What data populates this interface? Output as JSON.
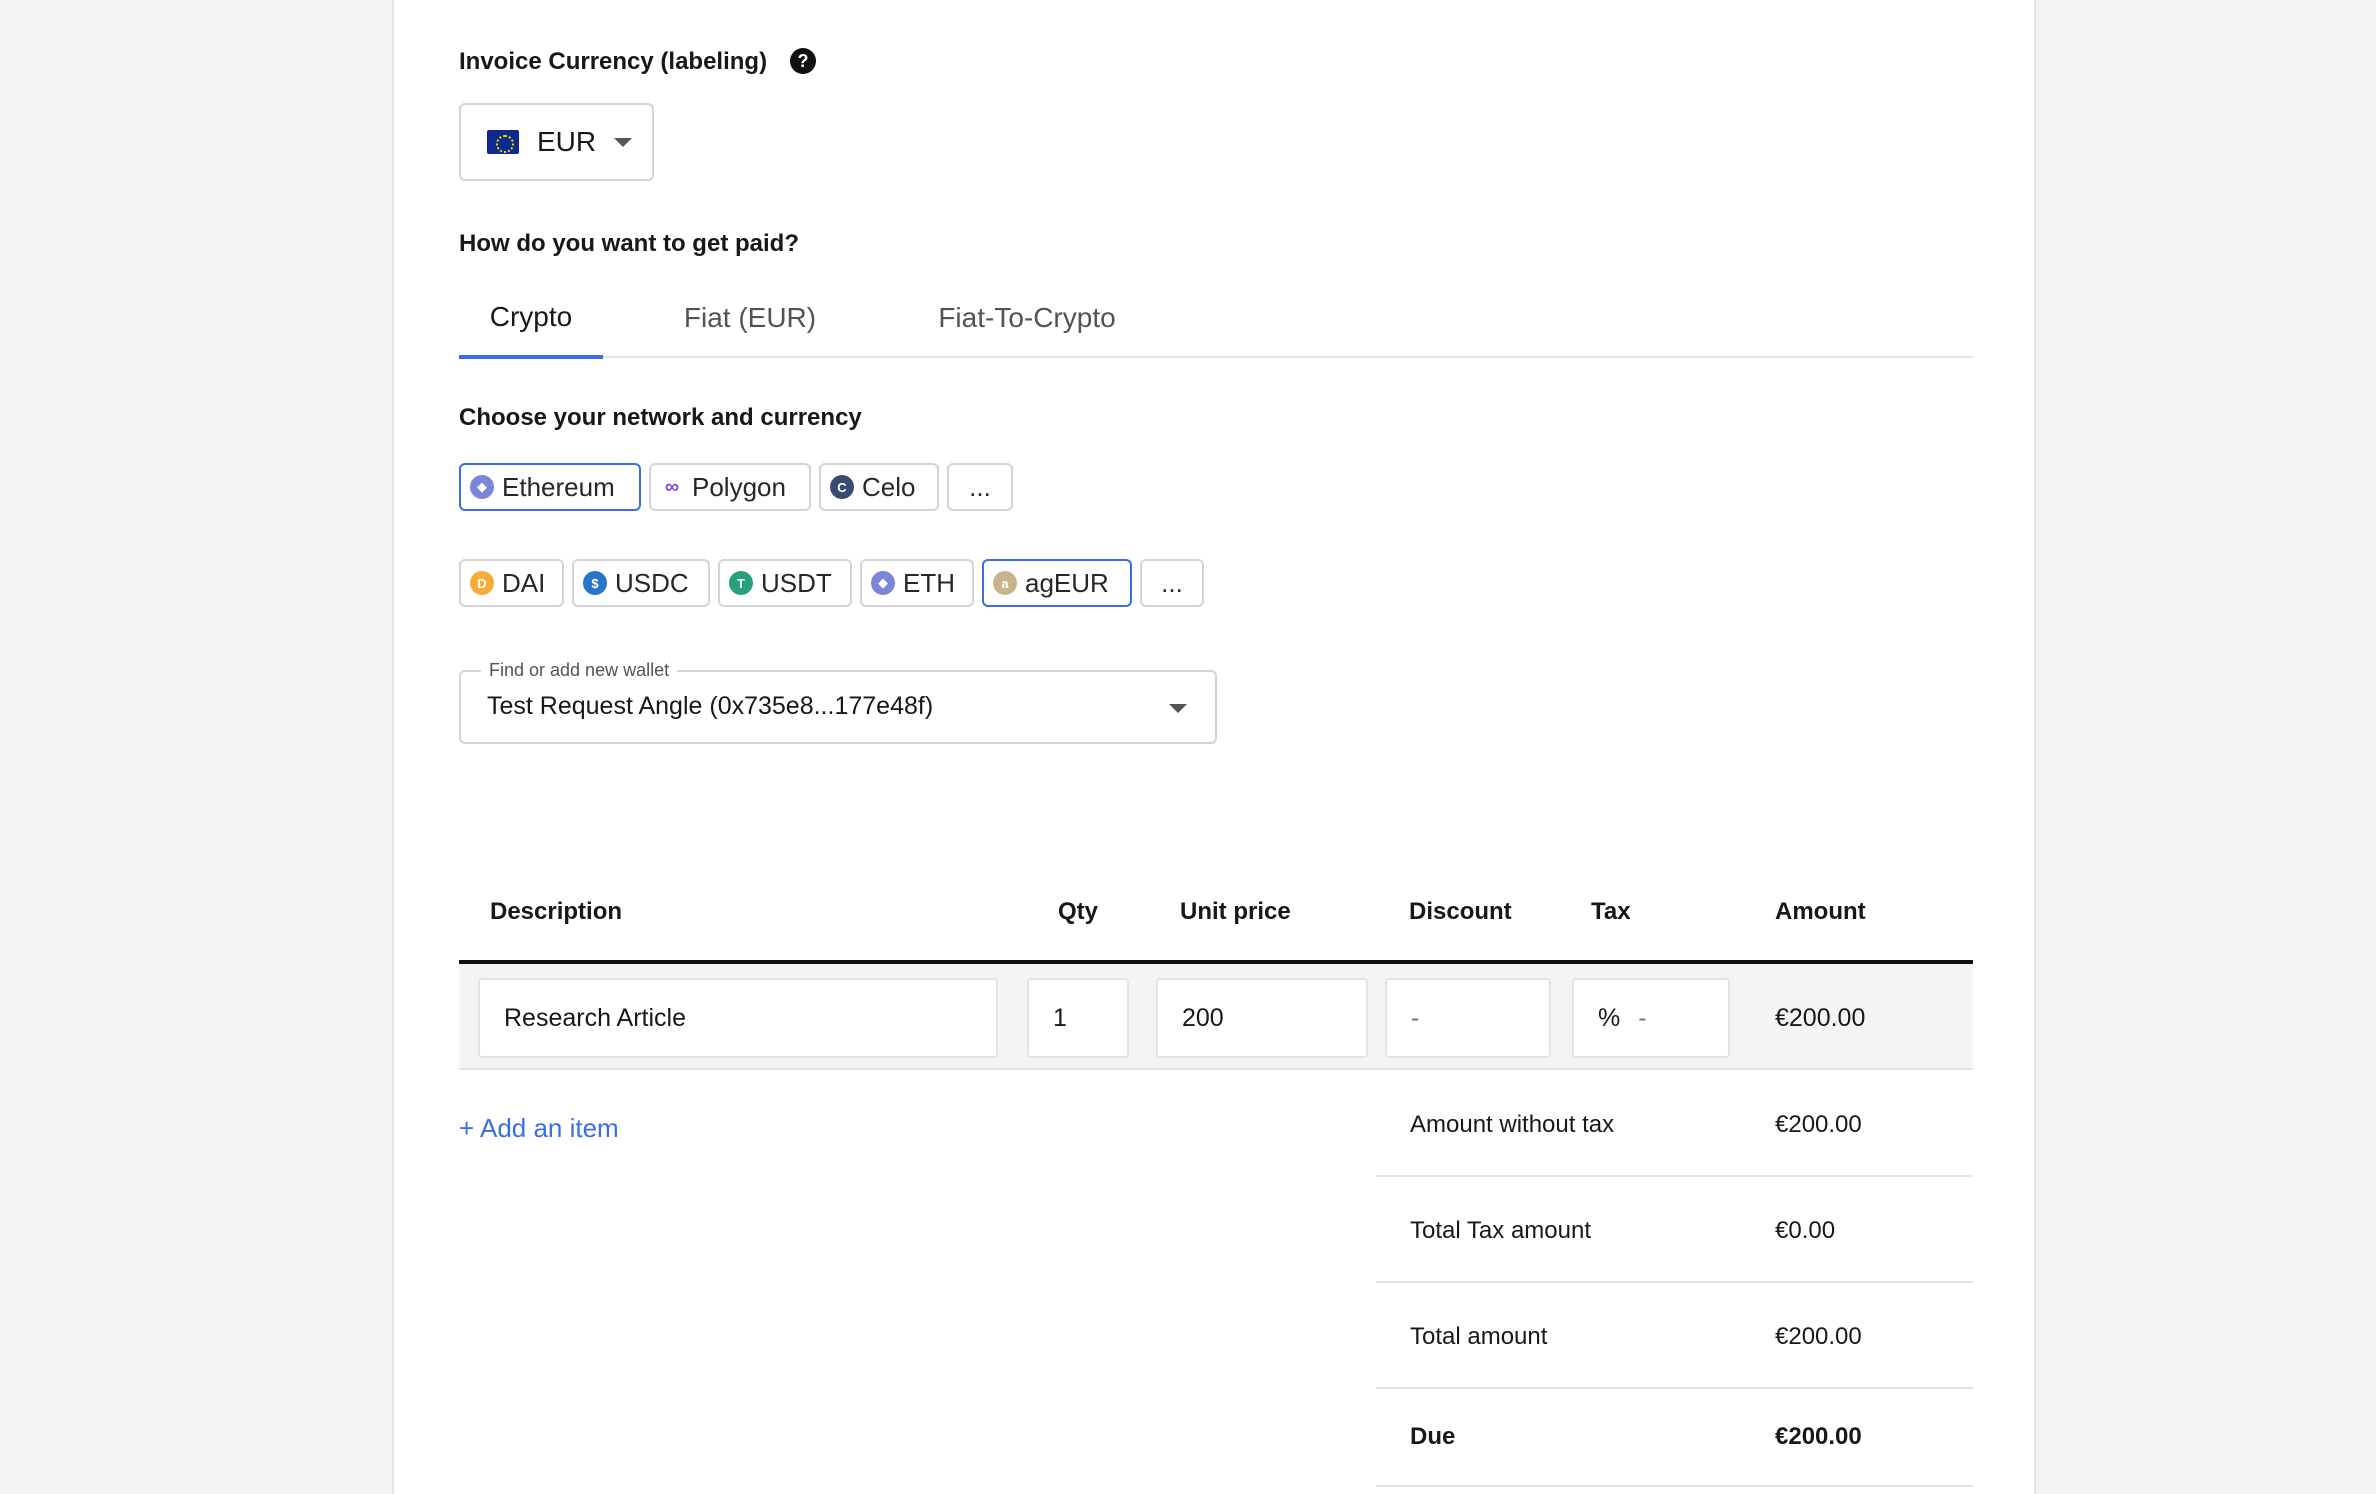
{
  "invoice_currency": {
    "label": "Invoice Currency (labeling)",
    "help_icon": "?",
    "selected": "EUR",
    "flag_icon": "eu-flag-icon"
  },
  "payment": {
    "question": "How do you want to get paid?",
    "tabs": [
      "Crypto",
      "Fiat (EUR)",
      "Fiat-To-Crypto"
    ],
    "active_tab": "Crypto",
    "accent_color": "#3b6fe0"
  },
  "network": {
    "label": "Choose your network and currency",
    "networks": [
      "Ethereum",
      "Polygon",
      "Celo",
      "..."
    ],
    "selected_network": "Ethereum",
    "currencies": [
      "DAI",
      "USDC",
      "USDT",
      "ETH",
      "agEUR",
      "..."
    ],
    "selected_currency": "agEUR"
  },
  "wallet": {
    "legend": "Find or add new wallet",
    "value": "Test Request Angle (0x735e8...177e48f)"
  },
  "table": {
    "headers": {
      "description": "Description",
      "qty": "Qty",
      "unit_price": "Unit price",
      "discount": "Discount",
      "tax": "Tax",
      "amount": "Amount"
    },
    "row": {
      "description": "Research Article",
      "qty": "1",
      "unit_price": "200",
      "discount": "-",
      "tax_unit": "%",
      "tax": "-",
      "amount": "€200.00"
    },
    "add_item": "+ Add an item"
  },
  "summary": {
    "amount_without_tax_label": "Amount without tax",
    "amount_without_tax": "€200.00",
    "total_tax_label": "Total Tax amount",
    "total_tax": "€0.00",
    "total_amount_label": "Total amount",
    "total_amount": "€200.00",
    "due_label": "Due",
    "due": "€200.00"
  }
}
